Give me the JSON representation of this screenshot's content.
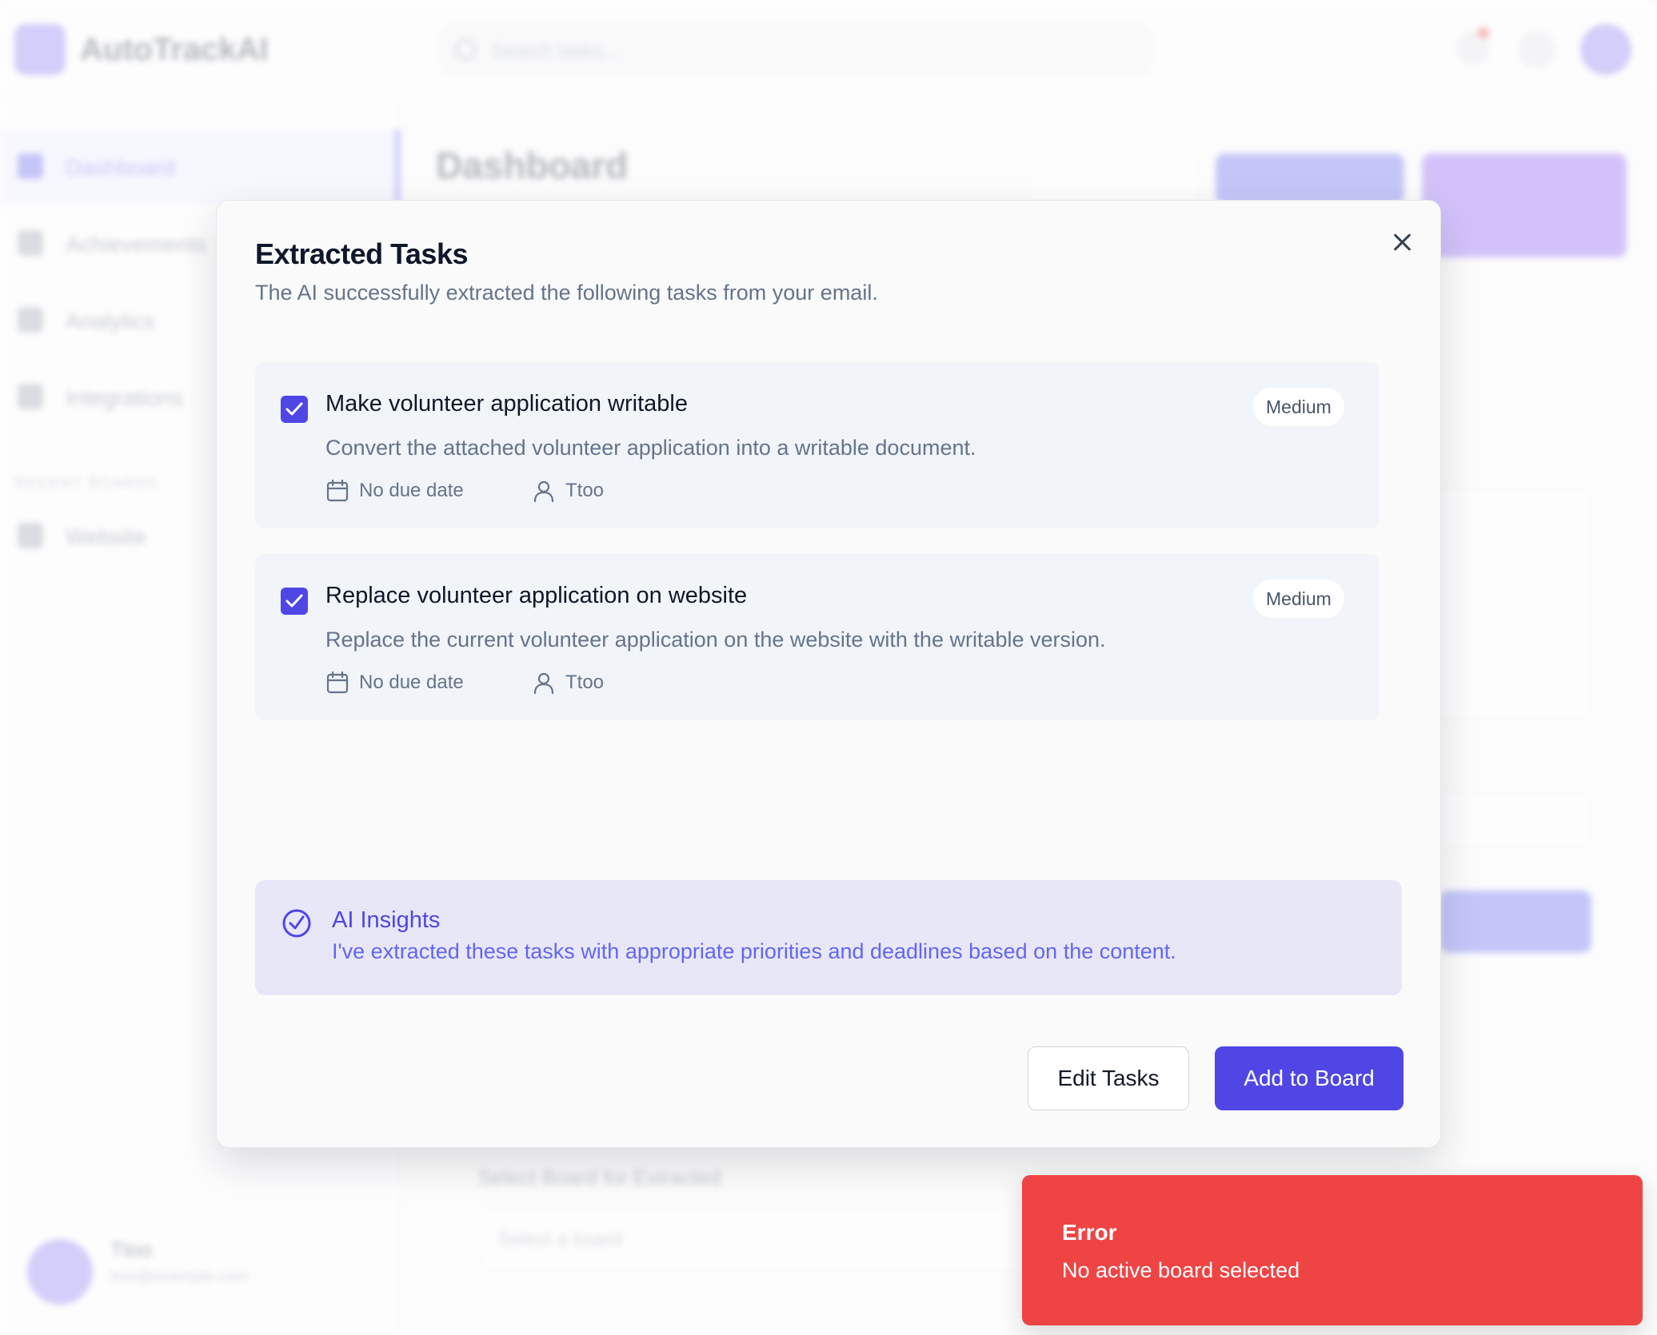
{
  "app": {
    "name": "AutoTrackAI",
    "search_placeholder": "Search tasks...",
    "sidebar": {
      "items": [
        {
          "label": "Dashboard"
        },
        {
          "label": "Achievements"
        },
        {
          "label": "Analytics"
        },
        {
          "label": "Integrations"
        }
      ],
      "section_label": "RECENT BOARDS",
      "boards": [
        {
          "label": "Website"
        }
      ],
      "user": {
        "name": "Ttoo",
        "subtitle": "ttoo@example.com"
      }
    },
    "main": {
      "title": "Dashboard",
      "select_board_label": "Select Board for Extracted",
      "select_placeholder": "Select a board"
    }
  },
  "modal": {
    "title": "Extracted Tasks",
    "subtitle": "The AI successfully extracted the following tasks from your email.",
    "tasks": [
      {
        "title": "Make volunteer application writable",
        "description": "Convert the attached volunteer application into a writable document.",
        "due": "No due date",
        "assignee": "Ttoo",
        "priority": "Medium",
        "checked": true
      },
      {
        "title": "Replace volunteer application on website",
        "description": "Replace the current volunteer application on the website with the writable version.",
        "due": "No due date",
        "assignee": "Ttoo",
        "priority": "Medium",
        "checked": true
      }
    ],
    "insights": {
      "title": "AI Insights",
      "text": "I've extracted these tasks with appropriate priorities and deadlines based on the content."
    },
    "edit_label": "Edit Tasks",
    "add_label": "Add to Board"
  },
  "toast": {
    "title": "Error",
    "message": "No active board selected"
  },
  "colors": {
    "accent": "#4f46e5",
    "error": "#ef4444",
    "insights_bg": "#e8e7f8"
  }
}
